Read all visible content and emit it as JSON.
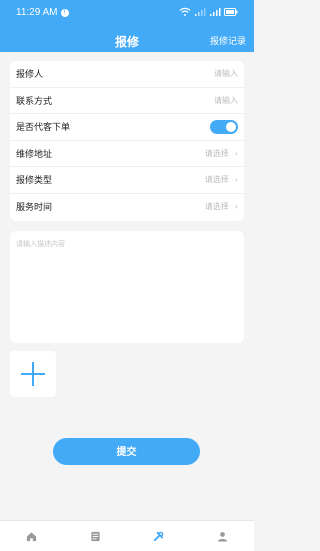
{
  "status_bar": {
    "time": "11:29 AM"
  },
  "header": {
    "title": "报修",
    "action": "报修记录"
  },
  "form": {
    "rows": [
      {
        "label": "报修人",
        "hint": "请输入"
      },
      {
        "label": "联系方式",
        "hint": "请输入"
      },
      {
        "label": "是否代客下单",
        "toggle_on": true
      },
      {
        "label": "维修地址",
        "hint": "请选择"
      },
      {
        "label": "报修类型",
        "hint": "请选择"
      },
      {
        "label": "服务时间",
        "hint": "请选择"
      }
    ]
  },
  "description": {
    "placeholder": "请输入描述内容",
    "value": ""
  },
  "submit_label": "提交",
  "tabbar": {
    "tabs": [
      {
        "icon": "home-icon",
        "active": false
      },
      {
        "icon": "order-icon",
        "active": false
      },
      {
        "icon": "repair-icon",
        "active": true
      },
      {
        "icon": "user-icon",
        "active": false
      }
    ]
  },
  "colors": {
    "accent": "#42aaf7",
    "background": "#f4f4f4"
  }
}
